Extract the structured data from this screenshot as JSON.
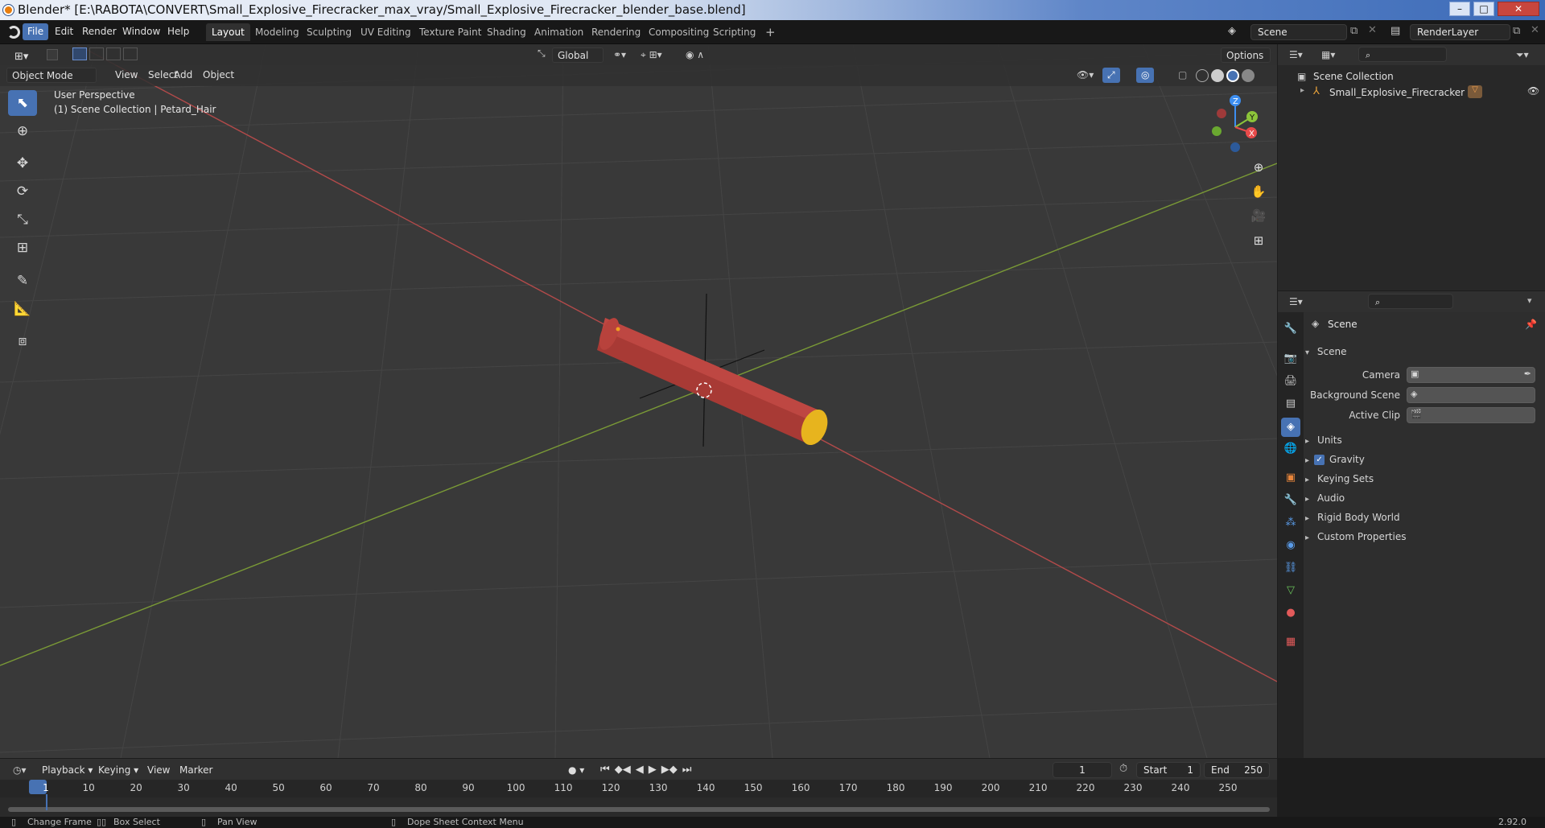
{
  "window": {
    "title": "Blender* [E:\\RABOTA\\CONVERT\\Small_Explosive_Firecracker_max_vray/Small_Explosive_Firecracker_blender_base.blend]",
    "minimize": "–",
    "maximize": "□",
    "close": "✕"
  },
  "topbar": {
    "menus": [
      "File",
      "Edit",
      "Render",
      "Window",
      "Help"
    ],
    "workspaces": [
      "Layout",
      "Modeling",
      "Sculpting",
      "UV Editing",
      "Texture Paint",
      "Shading",
      "Animation",
      "Rendering",
      "Compositing",
      "Scripting"
    ],
    "add_workspace": "+",
    "scene_value": "Scene",
    "view_layer_value": "RenderLayer"
  },
  "viewport": {
    "mode": "Object Mode",
    "menus": [
      "View",
      "Select",
      "Add",
      "Object"
    ],
    "transform_orientation": "Global",
    "options_label": "Options",
    "overlay_line1": "User Perspective",
    "overlay_line2": "(1) Scene Collection | Petard_Hair",
    "gizmo_x": "X",
    "gizmo_y": "Y",
    "gizmo_z": "Z",
    "colors": {
      "x_axis": "#e84a4a",
      "y_axis": "#8cc43a",
      "z_axis": "#3d8ef0",
      "accent": "#4772b3"
    }
  },
  "outliner": {
    "root": "Scene Collection",
    "items": [
      {
        "label": "Small_Explosive_Firecracker"
      }
    ]
  },
  "properties": {
    "context_title": "Scene",
    "section_title": "Scene",
    "fields": [
      {
        "label": "Camera",
        "value": ""
      },
      {
        "label": "Background Scene",
        "value": ""
      },
      {
        "label": "Active Clip",
        "value": ""
      }
    ],
    "subpanels": [
      "Units",
      "Gravity",
      "Keying Sets",
      "Audio",
      "Rigid Body World",
      "Custom Properties"
    ],
    "gravity_checked": true
  },
  "timeline": {
    "menus": [
      "Playback",
      "Keying",
      "View",
      "Marker"
    ],
    "current_frame": "1",
    "start_label": "Start",
    "start_value": "1",
    "end_label": "End",
    "end_value": "250",
    "ruler_ticks": [
      "1",
      "10",
      "20",
      "30",
      "40",
      "50",
      "60",
      "70",
      "80",
      "90",
      "100",
      "110",
      "120",
      "130",
      "140",
      "150",
      "160",
      "170",
      "180",
      "190",
      "200",
      "210",
      "220",
      "230",
      "240",
      "250"
    ]
  },
  "statusbar": {
    "items": [
      "Change Frame",
      "Box Select",
      "Pan View",
      "Dope Sheet Context Menu"
    ],
    "version": "2.92.0"
  }
}
